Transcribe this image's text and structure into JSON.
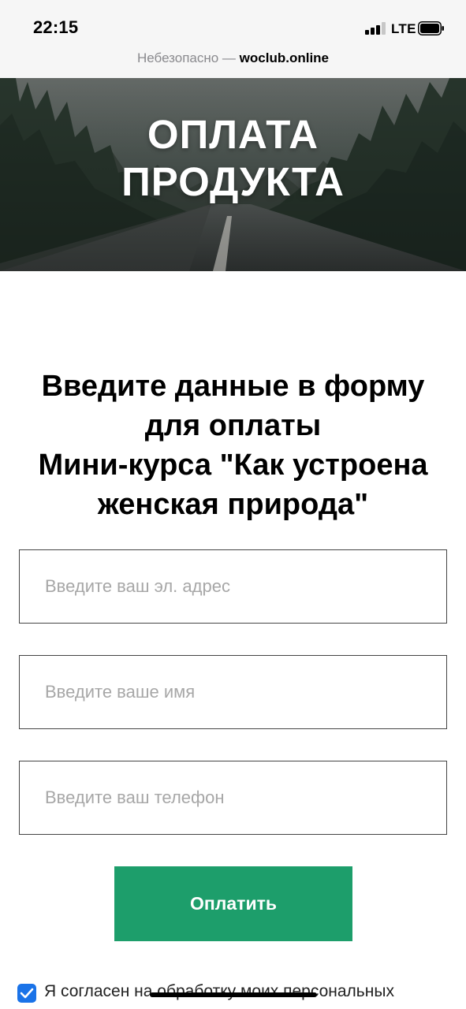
{
  "status_bar": {
    "time": "22:15",
    "network": "LTE",
    "icons": [
      "cellular-signal-icon",
      "battery-icon"
    ]
  },
  "address_bar": {
    "security_text": "Небезопасно —",
    "domain": "woclub.online"
  },
  "hero": {
    "title_line1": "ОПЛАТА",
    "title_line2": "ПРОДУКТА"
  },
  "form": {
    "heading_line1": "Введите данные в форму",
    "heading_line2": "для оплаты",
    "heading_line3": "Мини-курса \"Как устроена",
    "heading_line4": "женская природа\"",
    "email_placeholder": "Введите ваш эл. адрес",
    "name_placeholder": "Введите ваше имя",
    "phone_placeholder": "Введите ваш телефон",
    "pay_label": "Оплатить",
    "consent_text": "Я согласен на обработку моих персональных",
    "consent_checked": true
  },
  "colors": {
    "button_green": "#1d9e6b",
    "checkbox_blue": "#1a73e8",
    "browser_chrome": "#f6f6f6"
  }
}
